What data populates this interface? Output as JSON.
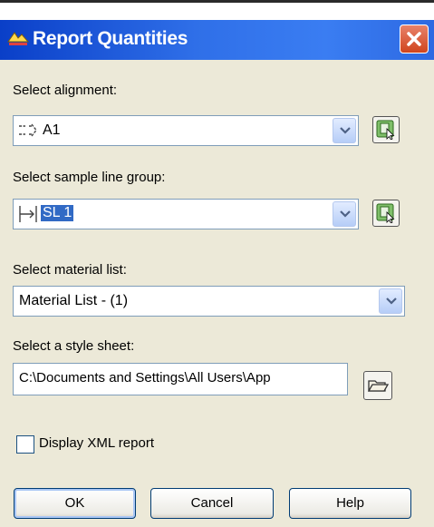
{
  "window": {
    "title": "Report Quantities"
  },
  "alignment": {
    "label": "Select alignment:",
    "value": "A1"
  },
  "sample_line_group": {
    "label": "Select sample line group:",
    "value": "SL 1"
  },
  "material_list": {
    "label": "Select material list:",
    "value": "Material List - (1)"
  },
  "style_sheet": {
    "label": "Select a style sheet:",
    "value": "C:\\Documents and Settings\\All Users\\App"
  },
  "xml_report": {
    "label": "Display XML report",
    "checked": false
  },
  "buttons": {
    "ok": "OK",
    "cancel": "Cancel",
    "help": "Help"
  },
  "colors": {
    "titlebar": "#2f6fe8",
    "dialog_bg": "#ece9d8",
    "selection": "#316ac5"
  }
}
